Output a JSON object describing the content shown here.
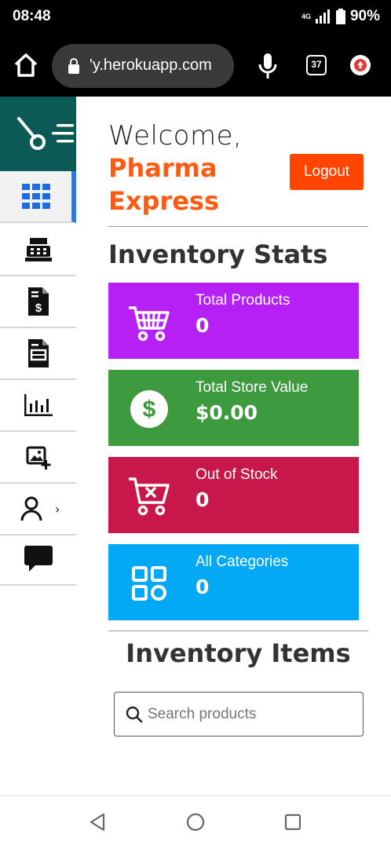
{
  "status_bar": {
    "time": "08:48",
    "network": "4G",
    "battery": "90%"
  },
  "browser": {
    "url": "'y.herokuapp.com",
    "tab_count": "37"
  },
  "sidebar": {
    "items": [
      {
        "icon": "dashboard-grid-icon",
        "active": true
      },
      {
        "icon": "cash-register-icon"
      },
      {
        "icon": "invoice-dollar-icon"
      },
      {
        "icon": "document-icon"
      },
      {
        "icon": "bar-chart-icon"
      },
      {
        "icon": "add-image-icon"
      },
      {
        "icon": "user-icon",
        "chevron": "›"
      },
      {
        "icon": "chat-icon"
      }
    ]
  },
  "header": {
    "welcome": "Welcome,",
    "brand_line1": "Pharma",
    "brand_line2": "Express",
    "logout_label": "Logout"
  },
  "stats": {
    "title": "Inventory Stats",
    "cards": [
      {
        "label": "Total Products",
        "value": "0",
        "color": "#b620f5",
        "icon": "cart-icon"
      },
      {
        "label": "Total Store Value",
        "value": "$0.00",
        "color": "#3d9a3f",
        "icon": "dollar-icon"
      },
      {
        "label": "Out of Stock",
        "value": "0",
        "color": "#c8174a",
        "icon": "cart-x-icon"
      },
      {
        "label": "All Categories",
        "value": "0",
        "color": "#03a9f4",
        "icon": "categories-icon"
      }
    ]
  },
  "items": {
    "title": "Inventory Items",
    "search_placeholder": "Search products"
  },
  "colors": {
    "accent": "#ff5a12",
    "sidebar_head": "#0b5a55",
    "active_marker": "#2c7be5"
  }
}
